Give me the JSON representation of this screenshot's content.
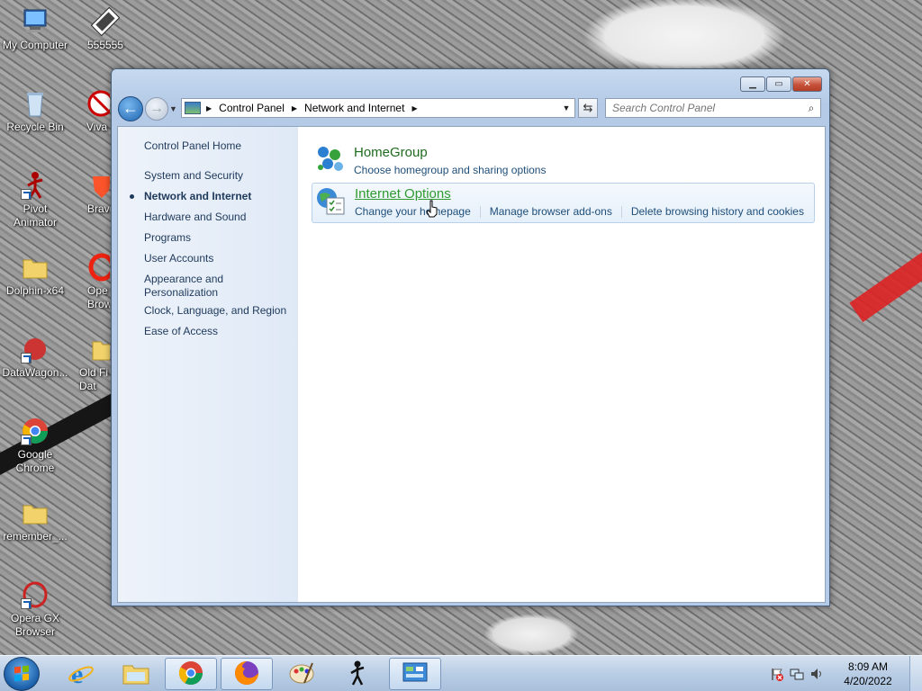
{
  "desktop": {
    "icons": [
      {
        "label": "My Computer",
        "icon": "computer-icon"
      },
      {
        "label": "555555",
        "icon": "film-strip-icon"
      },
      {
        "label": "Recycle Bin",
        "icon": "recycle-bin-icon"
      },
      {
        "label": "Viva",
        "icon": "app-icon"
      },
      {
        "label": "Pivot Animator",
        "icon": "stick-figure-icon"
      },
      {
        "label": "Brav",
        "icon": "brave-icon"
      },
      {
        "label": "Dolphin-x64",
        "icon": "folder-icon"
      },
      {
        "label": "Ope Brow",
        "icon": "opera-icon"
      },
      {
        "label": "DataWagon...",
        "icon": "datawagon-icon"
      },
      {
        "label": "Old Fi Dat",
        "icon": "folder-icon"
      },
      {
        "label": "Google Chrome",
        "icon": "chrome-icon"
      },
      {
        "label": "remember_...",
        "icon": "folder-icon"
      },
      {
        "label": "Opera GX Browser",
        "icon": "opera-gx-icon"
      }
    ]
  },
  "window": {
    "title_buttons": {
      "minimize": "minimize-icon",
      "maximize": "maximize-icon",
      "close": "close-icon"
    },
    "address": {
      "breadcrumbs": [
        "Control Panel",
        "Network and Internet"
      ]
    },
    "search": {
      "placeholder": "Search Control Panel"
    },
    "sidebar": {
      "home": "Control Panel Home",
      "items": [
        {
          "label": "System and Security"
        },
        {
          "label": "Network and Internet",
          "current": true
        },
        {
          "label": "Hardware and Sound"
        },
        {
          "label": "Programs"
        },
        {
          "label": "User Accounts"
        },
        {
          "label": "Appearance and Personalization"
        },
        {
          "label": "Clock, Language, and Region"
        },
        {
          "label": "Ease of Access"
        }
      ]
    },
    "categories": [
      {
        "title": "HomeGroup",
        "links": [
          "Choose homegroup and sharing options"
        ],
        "icon": "homegroup-icon"
      },
      {
        "title": "Internet Options",
        "links": [
          "Change your homepage",
          "Manage browser add-ons",
          "Delete browsing history and cookies"
        ],
        "icon": "internet-options-icon"
      }
    ]
  },
  "taskbar": {
    "buttons": [
      "internet-explorer-icon",
      "file-explorer-icon",
      "chrome-icon",
      "firefox-icon",
      "paint-icon",
      "pivot-animator-icon",
      "control-panel-icon"
    ],
    "clock": {
      "time": "8:09 AM",
      "date": "4/20/2022"
    }
  },
  "colors": {
    "accent": "#1e6b1e",
    "link": "#1e4e79",
    "sidebar_text": "#1e395b"
  }
}
